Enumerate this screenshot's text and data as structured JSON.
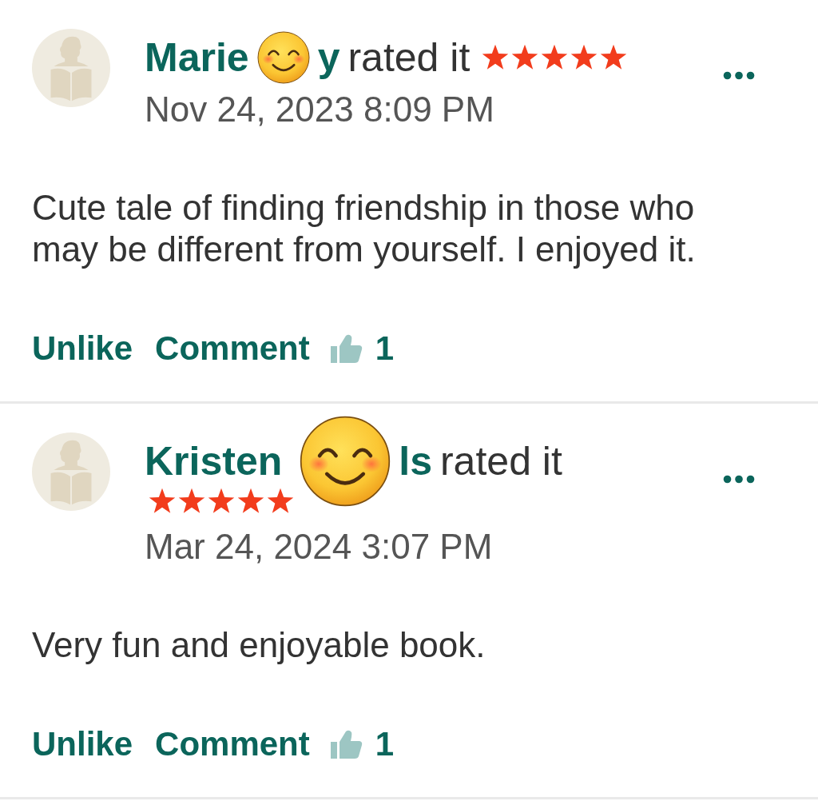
{
  "reviews": [
    {
      "reviewer": [
        {
          "kind": "text",
          "text": "Marie"
        },
        {
          "kind": "sticker-small"
        },
        {
          "kind": "text",
          "text": "y"
        }
      ],
      "verb": "rated it",
      "stars": 5,
      "timestamp": "Nov 24, 2023 8:09 PM",
      "text": "Cute tale of finding friendship in those who may be different from yourself. I enjoyed it.",
      "actions": [
        "Unlike",
        "Comment"
      ],
      "like_count": "1"
    },
    {
      "reviewer": [
        {
          "kind": "text",
          "text": "Kristen"
        },
        {
          "kind": "sticker-large"
        },
        {
          "kind": "text",
          "text": "ls"
        }
      ],
      "verb": "rated it",
      "stars": 5,
      "timestamp": "Mar 24, 2024 3:07 PM",
      "text": "Very fun and enjoyable book.",
      "actions": [
        "Unlike",
        "Comment"
      ],
      "like_count": "1"
    }
  ]
}
